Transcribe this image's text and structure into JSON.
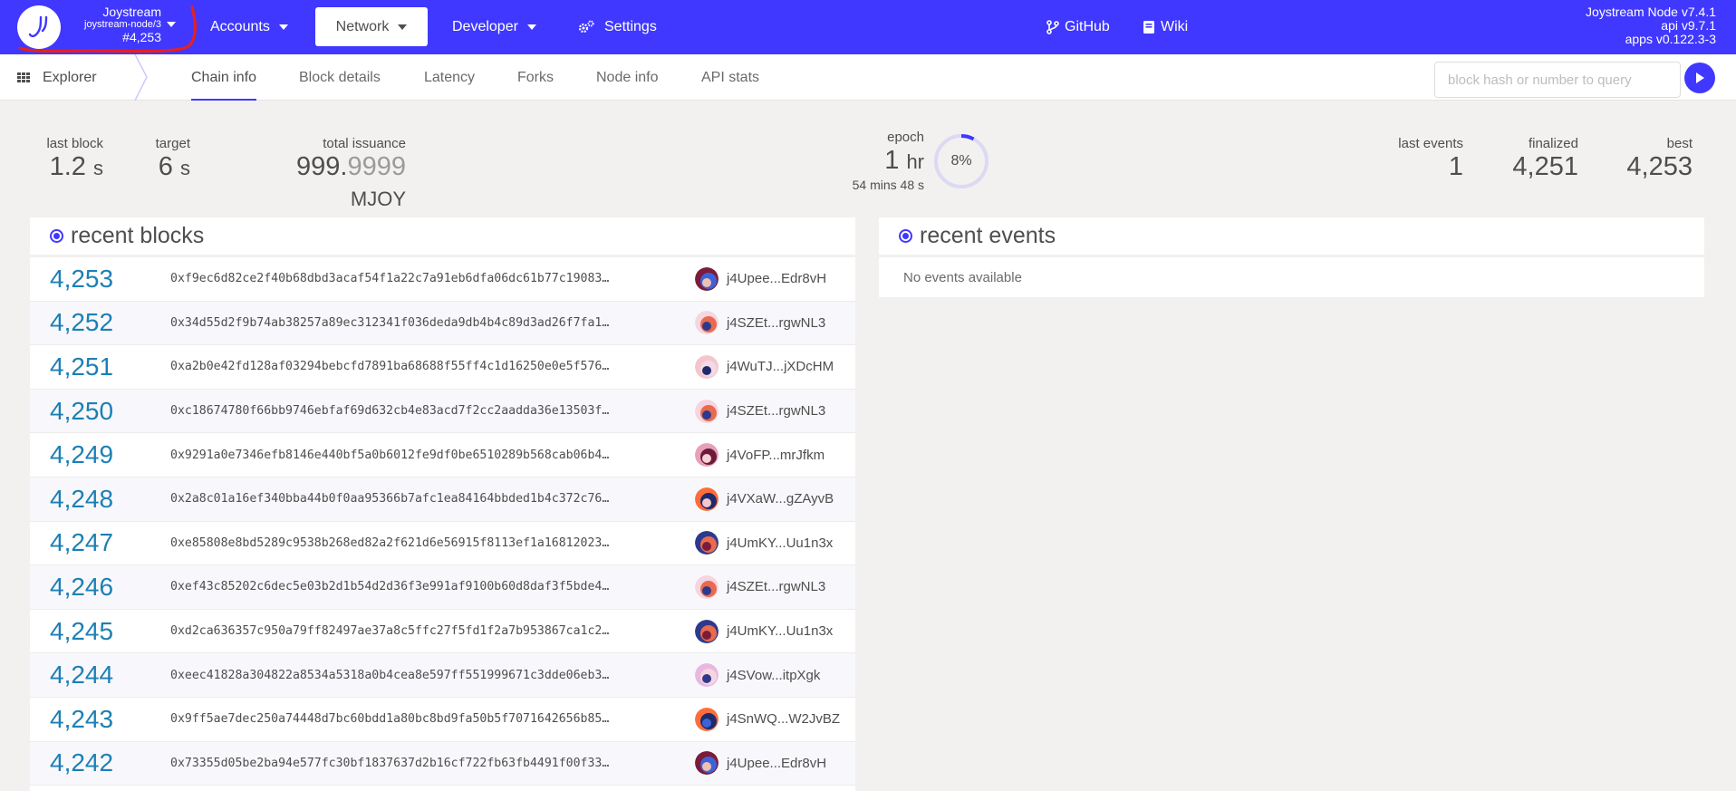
{
  "header": {
    "chain_name": "Joystream",
    "node_name": "joystream-node/3",
    "best_block": "#4,253",
    "menu": [
      {
        "label": "Accounts"
      },
      {
        "label": "Network"
      },
      {
        "label": "Developer"
      },
      {
        "label": "Settings"
      },
      {
        "label": "GitHub"
      },
      {
        "label": "Wiki"
      }
    ],
    "versions": {
      "node": "Joystream Node v7.4.1",
      "api": "api v9.7.1",
      "apps": "apps v0.122.3-3"
    }
  },
  "subnav": {
    "section": "Explorer",
    "tabs": [
      "Chain info",
      "Block details",
      "Latency",
      "Forks",
      "Node info",
      "API stats"
    ],
    "active_tab": "Chain info",
    "query_placeholder": "block hash or number to query"
  },
  "summary": {
    "last_block": {
      "label": "last block",
      "value": "1.2",
      "unit": "s"
    },
    "target": {
      "label": "target",
      "value": "6",
      "unit": "s"
    },
    "total_issuance": {
      "label": "total issuance",
      "int": "999.",
      "frac": "9999",
      "unit": "MJOY"
    },
    "epoch": {
      "label": "epoch",
      "value": "1",
      "unit": "hr",
      "sub": "54 mins 48 s",
      "percent": "8%",
      "progress": 0.08
    },
    "last_events": {
      "label": "last events",
      "value": "1"
    },
    "finalized": {
      "label": "finalized",
      "value": "4,251"
    },
    "best": {
      "label": "best",
      "value": "4,253"
    }
  },
  "recent_blocks": {
    "title": "recent blocks",
    "rows": [
      {
        "number": "4,253",
        "hash": "0xf9ec6d82ce2f40b68dbd3acaf54f1a22c7a91eb6dfa06dc61b77c19083…",
        "author": "j4Upee...Edr8vH"
      },
      {
        "number": "4,252",
        "hash": "0x34d55d2f9b74ab38257a89ec312341f036deda9db4b4c89d3ad26f7fa1…",
        "author": "j4SZEt...rgwNL3"
      },
      {
        "number": "4,251",
        "hash": "0xa2b0e42fd128af03294bebcfd7891ba68688f55ff4c1d16250e0e5f576…",
        "author": "j4WuTJ...jXDcHM"
      },
      {
        "number": "4,250",
        "hash": "0xc18674780f66bb9746ebfaf69d632cb4e83acd7f2cc2aadda36e13503f…",
        "author": "j4SZEt...rgwNL3"
      },
      {
        "number": "4,249",
        "hash": "0x9291a0e7346efb8146e440bf5a0b6012fe9df0be6510289b568cab06b4…",
        "author": "j4VoFP...mrJfkm"
      },
      {
        "number": "4,248",
        "hash": "0x2a8c01a16ef340bba44b0f0aa95366b7afc1ea84164bbded1b4c372c76…",
        "author": "j4VXaW...gZAyvB"
      },
      {
        "number": "4,247",
        "hash": "0xe85808e8bd5289c9538b268ed82a2f621d6e56915f8113ef1a16812023…",
        "author": "j4UmKY...Uu1n3x"
      },
      {
        "number": "4,246",
        "hash": "0xef43c85202c6dec5e03b2d1b54d2d36f3e991af9100b60d8daf3f5bde4…",
        "author": "j4SZEt...rgwNL3"
      },
      {
        "number": "4,245",
        "hash": "0xd2ca636357c950a79ff82497ae37a8c5ffc27f5fd1f2a7b953867ca1c2…",
        "author": "j4UmKY...Uu1n3x"
      },
      {
        "number": "4,244",
        "hash": "0xeec41828a304822a8534a5318a0b4cea8e597ff551999671c3dde06eb3…",
        "author": "j4SVow...itpXgk"
      },
      {
        "number": "4,243",
        "hash": "0x9ff5ae7dec250a74448d7bc60bdd1a80bc8bd9fa50b5f7071642656b85…",
        "author": "j4SnWQ...W2JvBZ"
      },
      {
        "number": "4,242",
        "hash": "0x73355d05be2ba94e577fc30bf1837637d2b16cf722fb63fb4491f00f33…",
        "author": "j4Upee...Edr8vH"
      }
    ]
  },
  "recent_events": {
    "title": "recent events",
    "empty": "No events available"
  },
  "colors": {
    "brand": "#4038ff",
    "block_number": "#1c80b4",
    "annotation": "#e8201c"
  }
}
